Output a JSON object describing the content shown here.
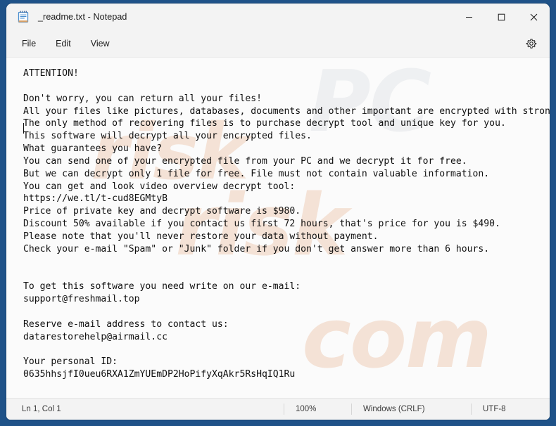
{
  "window": {
    "title": "_readme.txt - Notepad",
    "app_icon": "notepad-icon",
    "controls": {
      "minimize": "minimize-icon",
      "maximize": "maximize-icon",
      "close": "close-icon"
    }
  },
  "menu": {
    "items": [
      {
        "label": "File"
      },
      {
        "label": "Edit"
      },
      {
        "label": "View"
      }
    ],
    "settings_icon": "gear-icon"
  },
  "editor": {
    "text": "ATTENTION!\n\nDon't worry, you can return all your files!\nAll your files like pictures, databases, documents and other important are encrypted with strongest encryption and unique key.\nThe only method of recovering files is to purchase decrypt tool and unique key for you.\nThis software will decrypt all your encrypted files.\nWhat guarantees you have?\nYou can send one of your encrypted file from your PC and we decrypt it for free.\nBut we can decrypt only 1 file for free. File must not contain valuable information.\nYou can get and look video overview decrypt tool:\nhttps://we.tl/t-cud8EGMtyB\nPrice of private key and decrypt software is $980.\nDiscount 50% available if you contact us first 72 hours, that's price for you is $490.\nPlease note that you'll never restore your data without payment.\nCheck your e-mail \"Spam\" or \"Junk\" folder if you don't get answer more than 6 hours.\n\n\nTo get this software you need write on our e-mail:\nsupport@freshmail.top\n\nReserve e-mail address to contact us:\ndatarestorehelp@airmail.cc\n\nYour personal ID:\n0635hhsjfI0ueu6RXA1ZmYUEmDP2HoPifyXqAkr5RsHqIQ1Ru",
    "watermark": {
      "line1": "PC",
      "line2": "risk",
      "line3": "com",
      "line4": "risk"
    }
  },
  "status_bar": {
    "position": "Ln 1, Col 1",
    "zoom": "100%",
    "line_ending": "Windows (CRLF)",
    "encoding": "UTF-8"
  },
  "colors": {
    "desktop": "#1f5288",
    "window_chrome": "#f3f3f3",
    "editor_background": "#fbfbfb",
    "text": "#101010"
  }
}
